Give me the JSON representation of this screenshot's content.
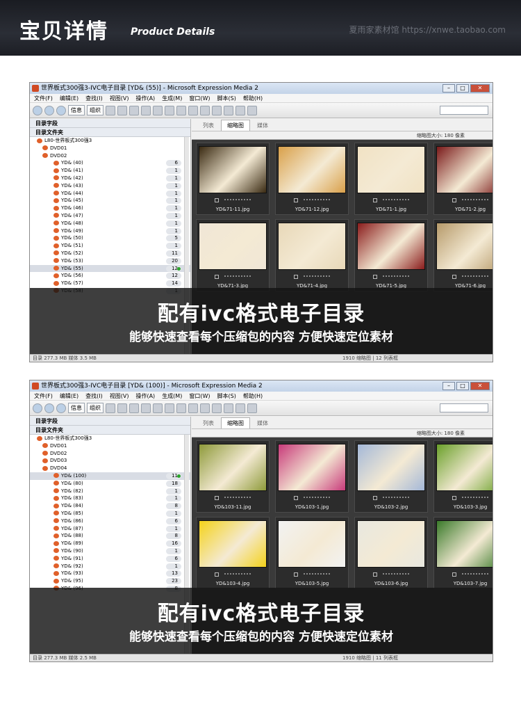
{
  "banner": {
    "title_cn": "宝贝详情",
    "title_en": "Product Details",
    "watermark": "夏雨家素材馆 https://xnwe.taobao.com"
  },
  "menu": [
    "文件(F)",
    "编辑(E)",
    "查找(I)",
    "视图(V)",
    "操作(A)",
    "生成(M)",
    "窗口(W)",
    "脚本(S)",
    "帮助(H)"
  ],
  "toolbar": {
    "info_label": "信息",
    "organize_label": "组织"
  },
  "panels": {
    "catalog_fields": "目录字段",
    "catalog_folders": "目录文件夹",
    "tab_list": "列表",
    "tab_thumbs": "缩略图",
    "tab_media": "媒体",
    "thumb_size": "缩略图大小: 180 像素"
  },
  "overlay": {
    "headline": "配有ivc格式电子目录",
    "subline": "能够快速查看每个压缩包的内容 方便快速定位素材"
  },
  "screens": [
    {
      "window_title": "世界板式300强3-IVC电子目录 [YD& (55)] - Microsoft Expression Media 2",
      "root": "L80-世界板式300强3",
      "drives": [
        "DVD01",
        "DVD02"
      ],
      "folders": [
        {
          "name": "YD& (40)",
          "count": "6"
        },
        {
          "name": "YD& (41)",
          "count": "1"
        },
        {
          "name": "YD& (42)",
          "count": "1"
        },
        {
          "name": "YD& (43)",
          "count": "1"
        },
        {
          "name": "YD& (44)",
          "count": "1"
        },
        {
          "name": "YD& (45)",
          "count": "1"
        },
        {
          "name": "YD& (46)",
          "count": "1"
        },
        {
          "name": "YD& (47)",
          "count": "1"
        },
        {
          "name": "YD& (48)",
          "count": "1"
        },
        {
          "name": "YD& (49)",
          "count": "1"
        },
        {
          "name": "YD& (50)",
          "count": "5"
        },
        {
          "name": "YD& (51)",
          "count": "1"
        },
        {
          "name": "YD& (52)",
          "count": "11"
        },
        {
          "name": "YD& (53)",
          "count": "20"
        },
        {
          "name": "YD& (55)",
          "count": "12",
          "selected": true
        },
        {
          "name": "YD& (56)",
          "count": "12"
        },
        {
          "name": "YD& (57)",
          "count": "14"
        },
        {
          "name": "YD& (58)",
          "count": "1"
        }
      ],
      "thumbs": [
        "YD&71-11.jpg",
        "YD&71-12.jpg",
        "YD&71-1.jpg",
        "YD&71-2.jpg",
        "YD&71-3.jpg",
        "YD&71-4.jpg",
        "YD&71-5.jpg",
        "YD&71-6.jpg"
      ],
      "status_left": "目录 277.3 MB 媒体 3.5 MB",
      "status_right": "1910 缩略图 | 12 列表框"
    },
    {
      "window_title": "世界板式300强3-IVC电子目录 [YD& (100)] - Microsoft Expression Media 2",
      "root": "L80-世界板式300强3",
      "drives": [
        "DVD01",
        "DVD02",
        "DVD03",
        "DVD04"
      ],
      "folders": [
        {
          "name": "YD& (100)",
          "count": "11",
          "selected": true
        },
        {
          "name": "YD& (80)",
          "count": "18"
        },
        {
          "name": "YD& (82)",
          "count": "1"
        },
        {
          "name": "YD& (83)",
          "count": "1"
        },
        {
          "name": "YD& (84)",
          "count": "8"
        },
        {
          "name": "YD& (85)",
          "count": "1"
        },
        {
          "name": "YD& (86)",
          "count": "6"
        },
        {
          "name": "YD& (87)",
          "count": "1"
        },
        {
          "name": "YD& (88)",
          "count": "8"
        },
        {
          "name": "YD& (89)",
          "count": "16"
        },
        {
          "name": "YD& (90)",
          "count": "1"
        },
        {
          "name": "YD& (91)",
          "count": "6"
        },
        {
          "name": "YD& (92)",
          "count": "1"
        },
        {
          "name": "YD& (93)",
          "count": "13"
        },
        {
          "name": "YD& (95)",
          "count": "23"
        },
        {
          "name": "YD& (96)",
          "count": "8"
        }
      ],
      "thumbs": [
        "YD&103-11.jpg",
        "YD&103-1.jpg",
        "YD&103-2.jpg",
        "YD&103-3.jpg",
        "YD&103-4.jpg",
        "YD&103-5.jpg",
        "YD&103-6.jpg",
        "YD&103-7.jpg"
      ],
      "status_left": "目录 277.3 MB 媒体 2.5 MB",
      "status_right": "1910 缩略图 | 11 列表框"
    }
  ],
  "thumb_colors": [
    [
      "#3a2a12",
      "#d9a04a",
      "#f1e2c4",
      "#7a1a1a",
      "#f0e6d6",
      "#e8d8b8",
      "#8a1c1c",
      "#b69a6a"
    ],
    [
      "#8e9a3a",
      "#c83a7a",
      "#a4b8d8",
      "#6aa02a",
      "#f4d21a",
      "#f2f2f2",
      "#e8e8e0",
      "#3a7a2a"
    ]
  ]
}
